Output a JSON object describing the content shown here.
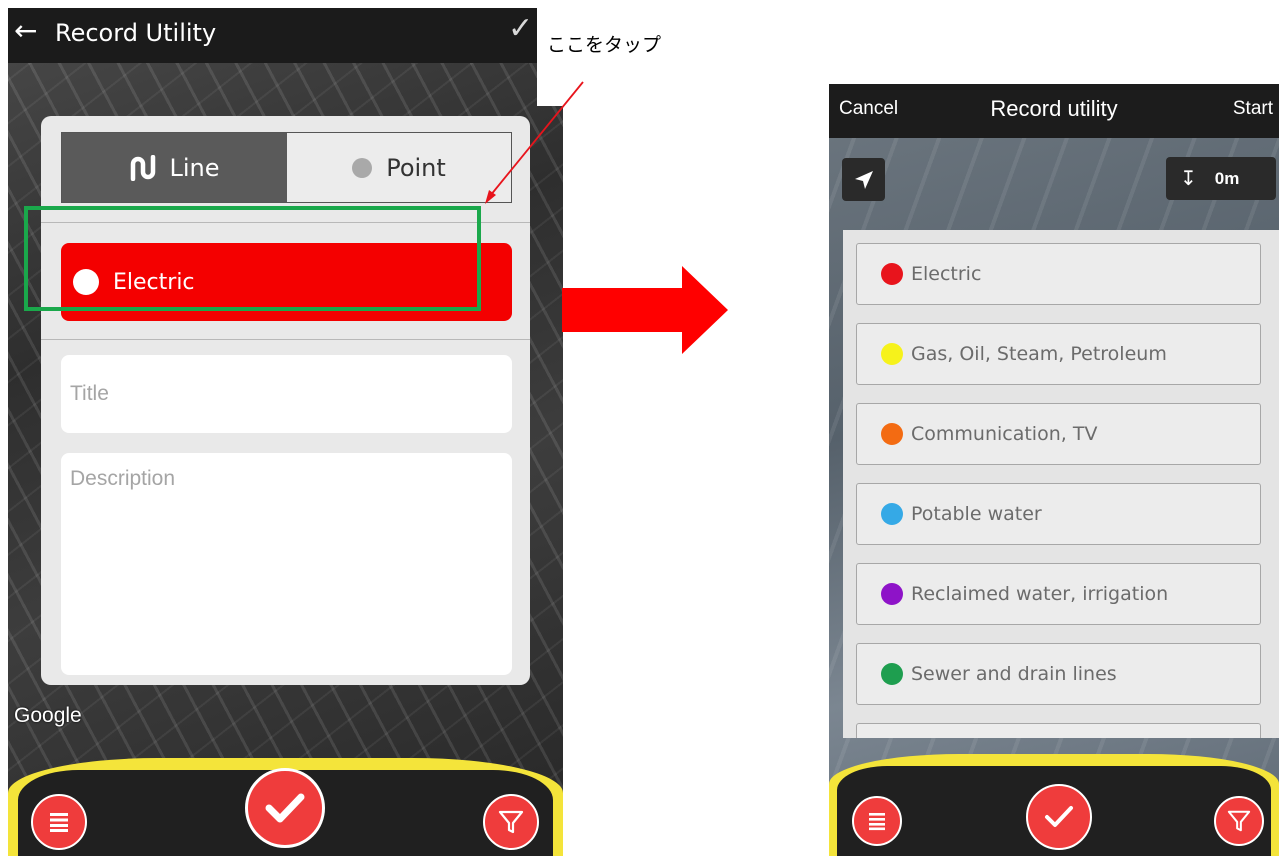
{
  "left_screen": {
    "app_bar": {
      "title": "Record Utility"
    },
    "segment": {
      "line_label": "Line",
      "point_label": "Point"
    },
    "utility_type": {
      "label": "Electric",
      "color": "#f40000"
    },
    "title_field": {
      "placeholder": "Title"
    },
    "description_field": {
      "placeholder": "Description"
    },
    "map_attribution": "Google"
  },
  "annotation": {
    "callout_text": "ここをタップ",
    "highlight_color": "#1aa84b",
    "arrow_color": "#ff0000"
  },
  "right_screen": {
    "top_bar": {
      "cancel_label": "Cancel",
      "title": "Record utility",
      "start_label": "Start"
    },
    "depth_label": "0m",
    "utility_types": [
      {
        "label": "Electric",
        "color": "#e8141c"
      },
      {
        "label": "Gas, Oil, Steam, Petroleum",
        "color": "#f6f21b"
      },
      {
        "label": "Communication, TV",
        "color": "#f36b12"
      },
      {
        "label": "Potable water",
        "color": "#35a9e6"
      },
      {
        "label": "Reclaimed water, irrigation",
        "color": "#8e13c8"
      },
      {
        "label": "Sewer and drain lines",
        "color": "#1e9e4f"
      }
    ]
  },
  "icons": {
    "back": "arrow-left-icon",
    "confirm": "checkmark-icon",
    "list": "list-icon",
    "filter": "filter-icon",
    "location": "navigation-arrow-icon",
    "depth": "depth-icon"
  },
  "theme": {
    "accent_red": "#ef3c3c",
    "bar_yellow": "#f4e43a",
    "bar_dark": "#202020"
  }
}
